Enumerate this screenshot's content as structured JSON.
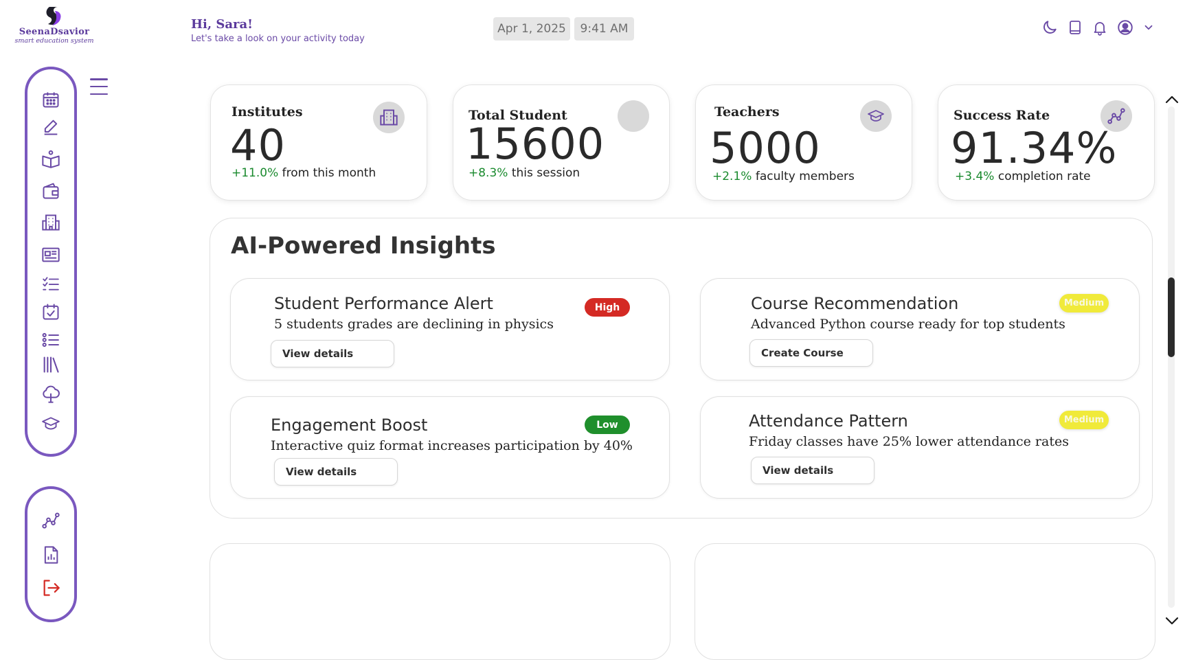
{
  "brand": {
    "name": "SeenaDsavior",
    "tagline": "smart education system"
  },
  "header": {
    "greeting": "Hi, Sara!",
    "subtitle": "Let's take a look on your activity today",
    "date": "Apr 1, 2025",
    "time": "9:41 AM",
    "icons": [
      "moon-icon",
      "book-icon",
      "bell-icon",
      "user-circle-icon",
      "chevron-down-icon"
    ]
  },
  "sidebar": {
    "main_items": [
      "calendar-icon",
      "pen-icon",
      "open-book-icon",
      "wallet-icon",
      "building-icon",
      "newspaper-icon",
      "checklist-icon",
      "calendar-check-icon",
      "list-icon",
      "library-icon",
      "tree-icon",
      "graduation-cap-icon"
    ],
    "bottom_items": [
      "analytics-icon",
      "report-icon",
      "logout-icon"
    ],
    "accent": "#7a58bf",
    "logout_color": "#d42a24"
  },
  "stats": [
    {
      "label": "Institutes",
      "value": "40",
      "delta": "+11.0%",
      "delta_text": "from this month",
      "icon": "building-icon"
    },
    {
      "label": "Total Student",
      "value": "15600",
      "delta": "+8.3%",
      "delta_text": "this session",
      "icon": "empty-circle"
    },
    {
      "label": "Teachers",
      "value": "5000",
      "delta": "+2.1%",
      "delta_text": "faculty members",
      "icon": "graduation-cap-icon"
    },
    {
      "label": "Success Rate",
      "value": "91.34%",
      "delta": "+3.4%",
      "delta_text": "completion rate",
      "icon": "analytics-icon"
    }
  ],
  "insights": {
    "title": "AI-Powered Insights",
    "cards": [
      {
        "title": "Student Performance Alert",
        "description": "5 students grades are declining in physics",
        "priority": "High",
        "button": "View details"
      },
      {
        "title": "Course Recommendation",
        "description": "Advanced Python course ready for top students",
        "priority": "Medium",
        "button": "Create Course"
      },
      {
        "title": "Engagement Boost",
        "description": "Interactive quiz format increases participation by 40%",
        "priority": "Low",
        "button": "View details"
      },
      {
        "title": "Attendance Pattern",
        "description": "Friday classes have 25% lower attendance rates",
        "priority": "Medium",
        "button": "View details"
      }
    ]
  },
  "colors": {
    "positive": "#1a8a2e",
    "high": "#d42a24",
    "low": "#1f8f2c",
    "medium": "#f0ea3a"
  }
}
